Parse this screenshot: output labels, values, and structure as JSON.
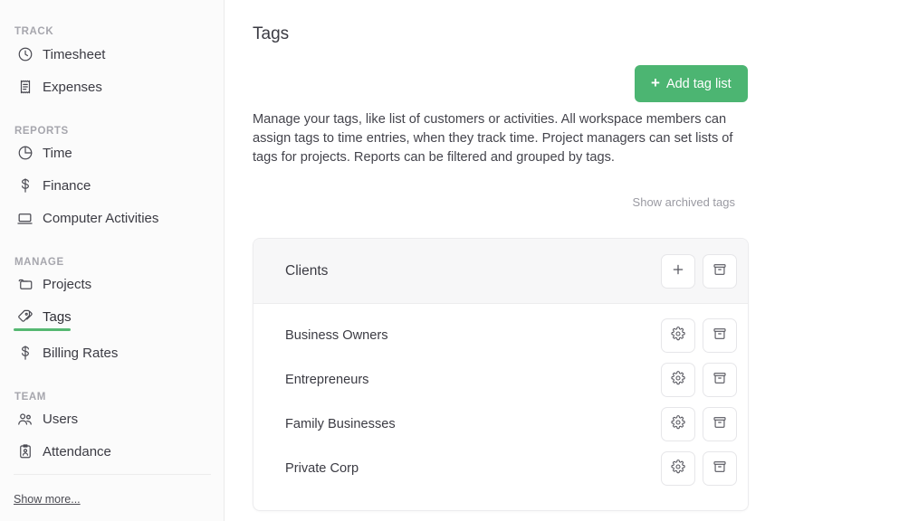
{
  "sidebar": {
    "sections": [
      {
        "label": "TRACK",
        "items": [
          {
            "label": "Timesheet",
            "icon": "clock-icon"
          },
          {
            "label": "Expenses",
            "icon": "receipt-icon"
          }
        ]
      },
      {
        "label": "REPORTS",
        "items": [
          {
            "label": "Time",
            "icon": "pie-chart-icon"
          },
          {
            "label": "Finance",
            "icon": "dollar-icon"
          },
          {
            "label": "Computer Activities",
            "icon": "laptop-icon"
          }
        ]
      },
      {
        "label": "MANAGE",
        "items": [
          {
            "label": "Projects",
            "icon": "folder-icon"
          },
          {
            "label": "Tags",
            "icon": "tag-icon"
          },
          {
            "label": "Billing Rates",
            "icon": "dollar-icon"
          }
        ]
      },
      {
        "label": "TEAM",
        "items": [
          {
            "label": "Users",
            "icon": "users-icon"
          },
          {
            "label": "Attendance",
            "icon": "clipboard-person-icon"
          }
        ]
      }
    ],
    "show_more": "Show more...",
    "active_item": "Tags",
    "active_accent": "#56b872"
  },
  "main": {
    "title": "Tags",
    "add_button": {
      "label": "Add tag list",
      "icon": "plus-icon",
      "color": "#4cb572"
    },
    "description": "Manage your tags, like list of customers or activities. All workspace members can assign tags to time entries, when they track time. Project managers can set lists of tags for projects. Reports can be filtered and grouped by tags.",
    "archived_link": "Show archived tags",
    "card": {
      "title": "Clients",
      "header_actions": [
        {
          "name": "add-tag-button",
          "icon": "plus-icon"
        },
        {
          "name": "archive-list-button",
          "icon": "archive-icon"
        }
      ],
      "rows": [
        {
          "name": "Business Owners"
        },
        {
          "name": "Entrepreneurs"
        },
        {
          "name": "Family Businesses"
        },
        {
          "name": "Private Corp"
        }
      ],
      "row_actions": [
        {
          "name": "tag-settings-button",
          "icon": "gear-icon"
        },
        {
          "name": "archive-tag-button",
          "icon": "archive-icon"
        }
      ]
    }
  }
}
